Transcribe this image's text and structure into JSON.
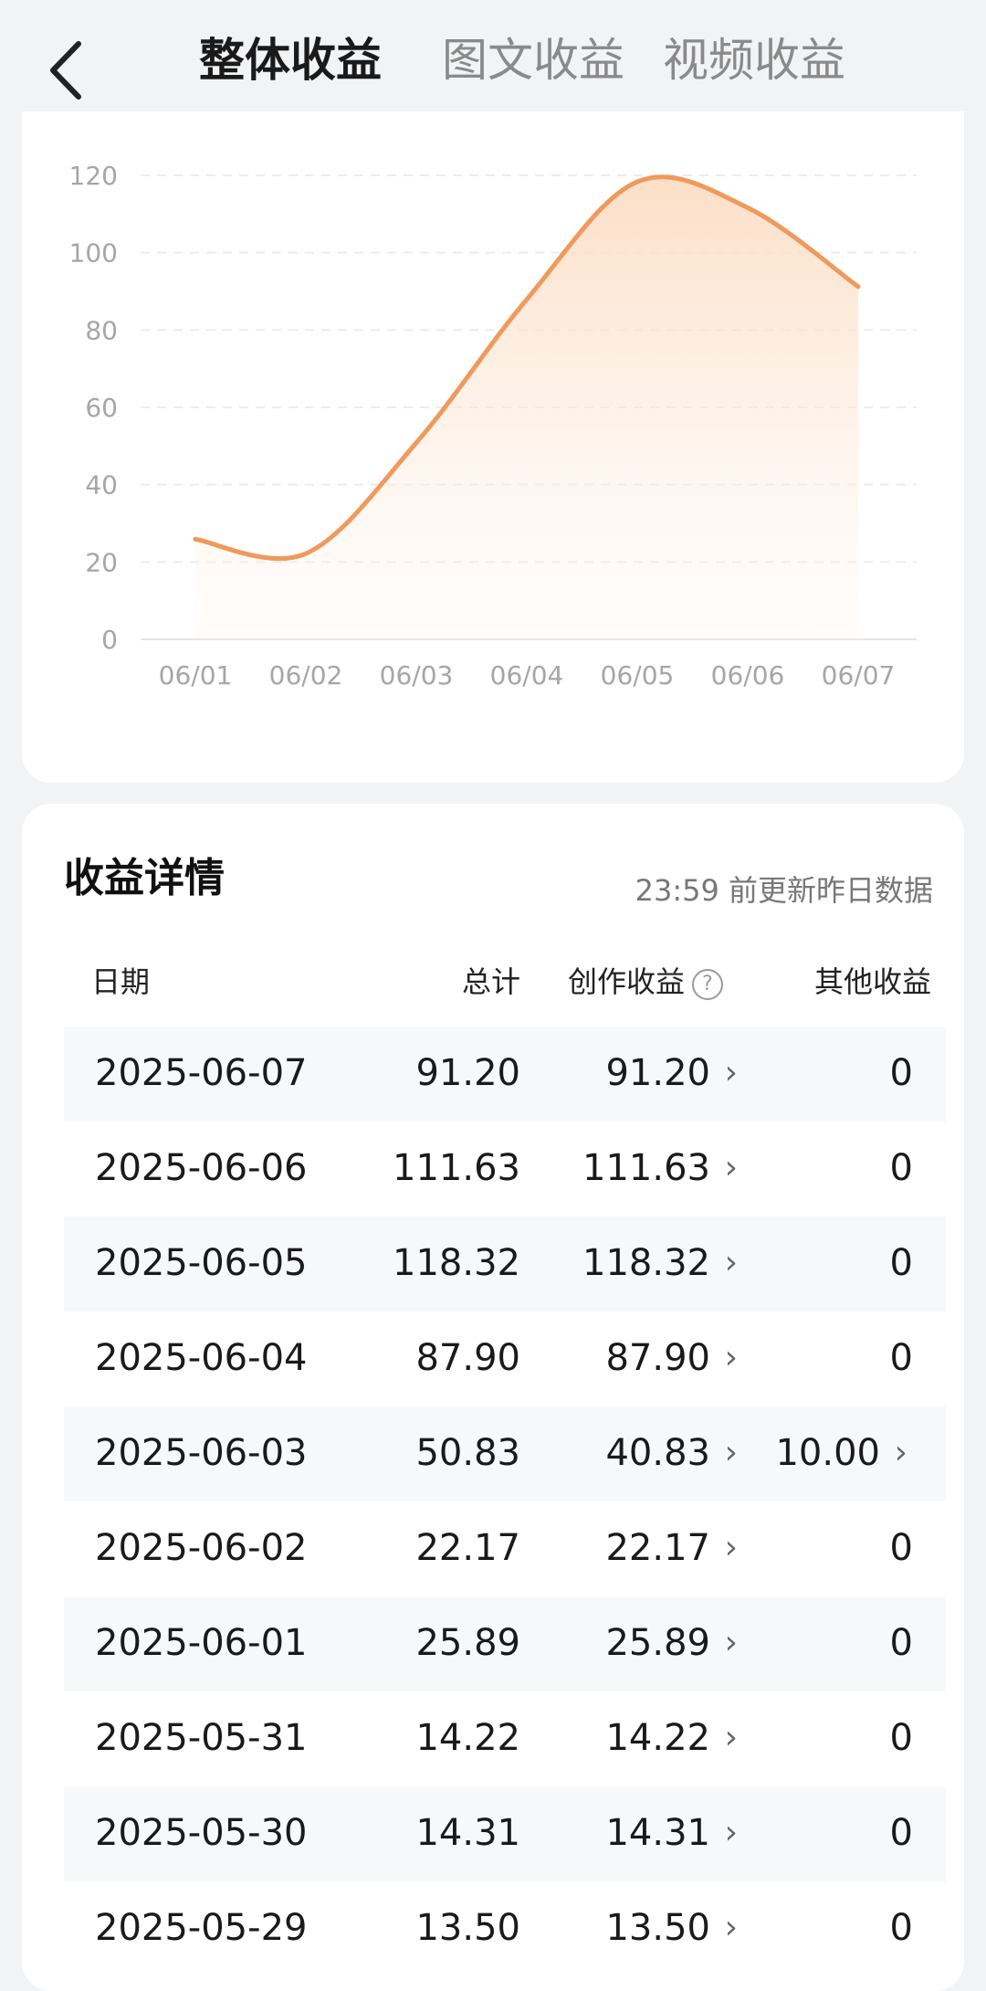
{
  "header": {
    "tabs": [
      "整体收益",
      "图文收益",
      "视频收益"
    ],
    "active_tab": 0
  },
  "chart_data": {
    "type": "area",
    "categories": [
      "06/01",
      "06/02",
      "06/03",
      "06/04",
      "06/05",
      "06/06",
      "06/07"
    ],
    "values": [
      25.89,
      22.17,
      50.83,
      87.9,
      118.32,
      111.63,
      91.2
    ],
    "yticks": [
      0,
      20,
      40,
      60,
      80,
      100,
      120
    ],
    "ylim": [
      0,
      120
    ],
    "grid": true,
    "color": "#ef9a5c"
  },
  "details": {
    "title": "收益详情",
    "update_note": "23:59 前更新昨日数据",
    "columns": {
      "date": "日期",
      "total": "总计",
      "creation": "创作收益",
      "other": "其他收益"
    },
    "help_icon": "?",
    "arrow": "›",
    "rows": [
      {
        "date": "2025-06-07",
        "total": "91.20",
        "creation": "91.20",
        "other": "0"
      },
      {
        "date": "2025-06-06",
        "total": "111.63",
        "creation": "111.63",
        "other": "0"
      },
      {
        "date": "2025-06-05",
        "total": "118.32",
        "creation": "118.32",
        "other": "0"
      },
      {
        "date": "2025-06-04",
        "total": "87.90",
        "creation": "87.90",
        "other": "0"
      },
      {
        "date": "2025-06-03",
        "total": "50.83",
        "creation": "40.83",
        "other": "10.00"
      },
      {
        "date": "2025-06-02",
        "total": "22.17",
        "creation": "22.17",
        "other": "0"
      },
      {
        "date": "2025-06-01",
        "total": "25.89",
        "creation": "25.89",
        "other": "0"
      },
      {
        "date": "2025-05-31",
        "total": "14.22",
        "creation": "14.22",
        "other": "0"
      },
      {
        "date": "2025-05-30",
        "total": "14.31",
        "creation": "14.31",
        "other": "0"
      },
      {
        "date": "2025-05-29",
        "total": "13.50",
        "creation": "13.50",
        "other": "0"
      }
    ]
  }
}
